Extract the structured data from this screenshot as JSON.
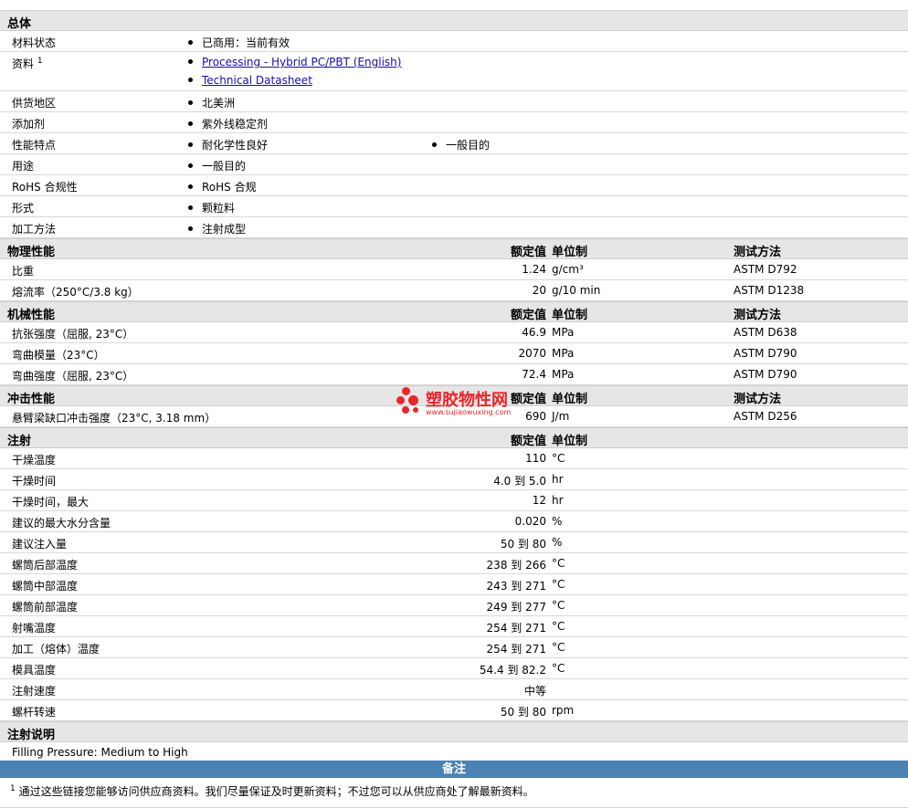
{
  "general": {
    "title": "总体",
    "rows": [
      {
        "label": "材料状态",
        "items": [
          "已商用：当前有效"
        ]
      },
      {
        "label": "资料",
        "sup": "1",
        "links": [
          "Processing - Hybrid PC/PBT (English)",
          "Technical Datasheet"
        ]
      },
      {
        "label": "供货地区",
        "items": [
          "北美洲"
        ]
      },
      {
        "label": "添加剂",
        "items": [
          "紫外线稳定剂"
        ]
      },
      {
        "label": "性能特点",
        "items": [
          "耐化学性良好",
          "一般目的"
        ]
      },
      {
        "label": "用途",
        "items": [
          "一般目的"
        ]
      },
      {
        "label": "RoHS 合规性",
        "items": [
          "RoHS 合规"
        ]
      },
      {
        "label": "形式",
        "items": [
          "颗粒料"
        ]
      },
      {
        "label": "加工方法",
        "items": [
          "注射成型"
        ]
      }
    ]
  },
  "headers": {
    "nominal": "额定值",
    "unit": "单位制",
    "method": "测试方法"
  },
  "physical": {
    "title": "物理性能",
    "rows": [
      {
        "label": "比重",
        "value": "1.24",
        "unit": "g/cm³",
        "method": "ASTM D792"
      },
      {
        "label": "熔流率（250°C/3.8 kg）",
        "value": "20",
        "unit": "g/10 min",
        "method": "ASTM D1238"
      }
    ]
  },
  "mechanical": {
    "title": "机械性能",
    "rows": [
      {
        "label": "抗张强度（屈服, 23°C）",
        "value": "46.9",
        "unit": "MPa",
        "method": "ASTM D638"
      },
      {
        "label": "弯曲模量（23°C）",
        "value": "2070",
        "unit": "MPa",
        "method": "ASTM D790"
      },
      {
        "label": "弯曲强度（屈服, 23°C）",
        "value": "72.4",
        "unit": "MPa",
        "method": "ASTM D790"
      }
    ]
  },
  "impact": {
    "title": "冲击性能",
    "rows": [
      {
        "label": "悬臂梁缺口冲击强度（23°C, 3.18 mm）",
        "value": "690",
        "unit": "J/m",
        "method": "ASTM D256"
      }
    ]
  },
  "injection": {
    "title": "注射",
    "rows": [
      {
        "label": "干燥温度",
        "value": "110",
        "unit": "°C"
      },
      {
        "label": "干燥时间",
        "value": "4.0 到 5.0",
        "unit": "hr"
      },
      {
        "label": "干燥时间，最大",
        "value": "12",
        "unit": "hr"
      },
      {
        "label": "建议的最大水分含量",
        "value": "0.020",
        "unit": "%"
      },
      {
        "label": "建议注入量",
        "value": "50 到 80",
        "unit": "%"
      },
      {
        "label": "螺筒后部温度",
        "value": "238 到 266",
        "unit": "°C"
      },
      {
        "label": "螺筒中部温度",
        "value": "243 到 271",
        "unit": "°C"
      },
      {
        "label": "螺筒前部温度",
        "value": "249 到 277",
        "unit": "°C"
      },
      {
        "label": "射嘴温度",
        "value": "254 到 271",
        "unit": "°C"
      },
      {
        "label": "加工（熔体）温度",
        "value": "254 到 271",
        "unit": "°C"
      },
      {
        "label": "模具温度",
        "value": "54.4 到 82.2",
        "unit": "°C"
      },
      {
        "label": "注射速度",
        "value": "中等",
        "unit": ""
      },
      {
        "label": "螺杆转速",
        "value": "50 到 80",
        "unit": "rpm"
      }
    ]
  },
  "injection_notes": {
    "title": "注射说明",
    "text": "Filling Pressure: Medium to High"
  },
  "notes": {
    "title": "备注",
    "sup": "1",
    "text": "通过这些链接您能够访问供应商资料。我们尽量保证及时更新资料；不过您可以从供应商处了解最新资料。"
  },
  "watermark": {
    "name": "塑胶物性网",
    "url": "www.sujiaowuxing.com"
  }
}
